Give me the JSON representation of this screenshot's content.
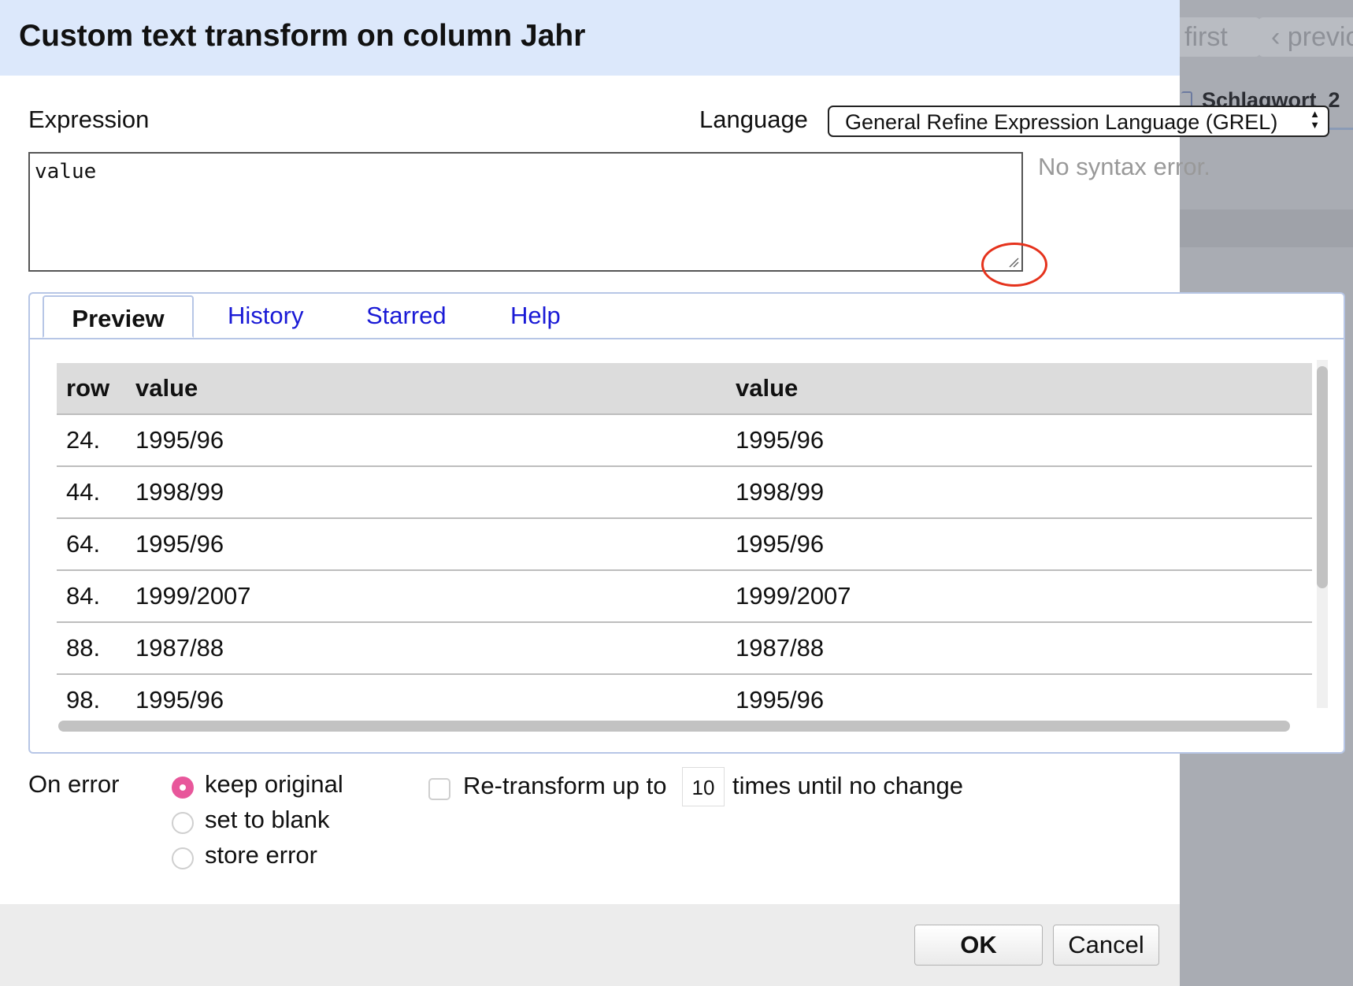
{
  "background": {
    "pager": {
      "first_label": "first",
      "previous_label": "‹ previo"
    },
    "column_header": "Schlagwort_2"
  },
  "dialog": {
    "title": "Custom text transform on column Jahr",
    "expression_label": "Expression",
    "language_label": "Language",
    "language_value": "General Refine Expression Language (GREL)",
    "expression_value": "value",
    "syntax_status": "No syntax error.",
    "tabs": [
      {
        "label": "Preview",
        "active": true
      },
      {
        "label": "History",
        "active": false
      },
      {
        "label": "Starred",
        "active": false
      },
      {
        "label": "Help",
        "active": false
      }
    ],
    "preview": {
      "headers": [
        "row",
        "value",
        "value"
      ],
      "rows": [
        {
          "row": "24.",
          "value": "1995/96",
          "result": "1995/96"
        },
        {
          "row": "44.",
          "value": "1998/99",
          "result": "1998/99"
        },
        {
          "row": "64.",
          "value": "1995/96",
          "result": "1995/96"
        },
        {
          "row": "84.",
          "value": "1999/2007",
          "result": "1999/2007"
        },
        {
          "row": "88.",
          "value": "1987/88",
          "result": "1987/88"
        },
        {
          "row": "98.",
          "value": "1995/96",
          "result": "1995/96"
        }
      ]
    },
    "on_error": {
      "label": "On error",
      "options": [
        {
          "label": "keep original",
          "checked": true
        },
        {
          "label": "set to blank",
          "checked": false
        },
        {
          "label": "store error",
          "checked": false
        }
      ]
    },
    "retransform": {
      "checked": false,
      "prefix": "Re-transform up to",
      "times": "10",
      "suffix": "times until no change"
    },
    "buttons": {
      "ok": "OK",
      "cancel": "Cancel"
    }
  },
  "colors": {
    "header_bg": "#dce8fb",
    "tab_link": "#1a1ad6",
    "radio_checked": "#e8579b",
    "highlight_circle": "#e5321c",
    "overlay": "#a9acb3"
  }
}
